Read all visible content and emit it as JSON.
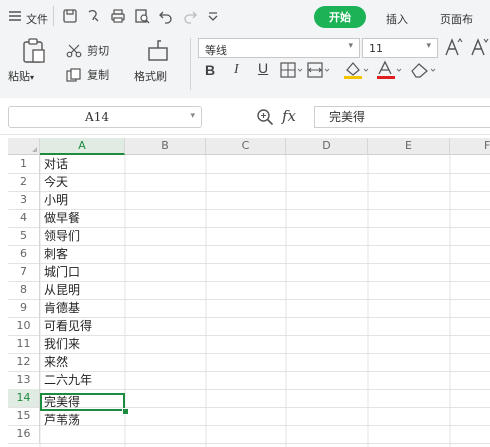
{
  "tabs": {
    "file_label": "文件",
    "home_label": "开始",
    "insert_label": "插入",
    "page_layout_label": "页面布"
  },
  "clipboard": {
    "paste_label": "粘贴",
    "cut_label": "剪切",
    "copy_label": "复制",
    "format_painter_label": "格式刷"
  },
  "font": {
    "name": "等线",
    "size": "11"
  },
  "formula_bar": {
    "cell_reference": "A14",
    "fx_label": "fx",
    "content": "完美得"
  },
  "grid": {
    "columns": [
      "A",
      "B",
      "C",
      "D",
      "E",
      "F"
    ],
    "rows": [
      {
        "num": "1",
        "a": "对话"
      },
      {
        "num": "2",
        "a": "今天"
      },
      {
        "num": "3",
        "a": "小明"
      },
      {
        "num": "4",
        "a": "做早餐"
      },
      {
        "num": "5",
        "a": "领导们"
      },
      {
        "num": "6",
        "a": "刺客"
      },
      {
        "num": "7",
        "a": "城门口"
      },
      {
        "num": "8",
        "a": "从昆明"
      },
      {
        "num": "9",
        "a": "肯德基"
      },
      {
        "num": "10",
        "a": "可看见得"
      },
      {
        "num": "11",
        "a": "我们来"
      },
      {
        "num": "12",
        "a": "来然"
      },
      {
        "num": "13",
        "a": "二六九年"
      },
      {
        "num": "14",
        "a": "完美得"
      },
      {
        "num": "15",
        "a": "芦苇荡"
      },
      {
        "num": "16",
        "a": ""
      }
    ],
    "selected_row": "14"
  },
  "colors": {
    "accent_green": "#1bb355",
    "selection_green": "#1e8c3f"
  }
}
